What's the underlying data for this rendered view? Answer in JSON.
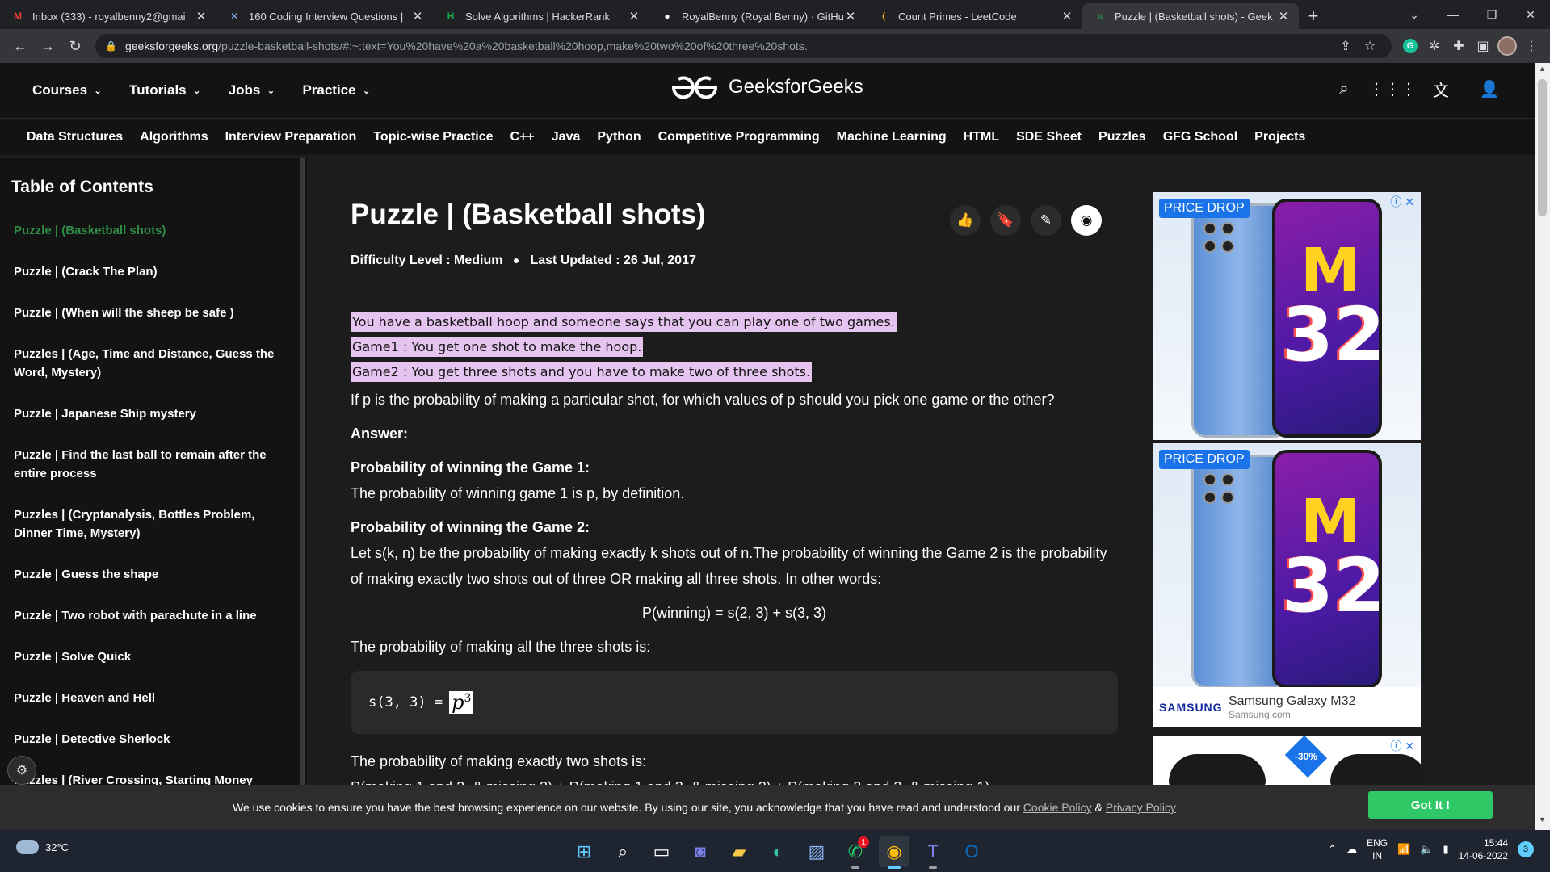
{
  "browser": {
    "tabs": [
      {
        "icon": "gmail-icon",
        "icon_char": "M",
        "icon_color": "#ea4335",
        "title": "Inbox (333) - royalbenny2@gmai"
      },
      {
        "icon": "x-close-icon",
        "icon_char": "✕",
        "icon_color": "#8ab4f8",
        "title": "160 Coding Interview Questions |"
      },
      {
        "icon": "hackerrank-icon",
        "icon_char": "H",
        "icon_color": "#1ba94c",
        "title": "Solve Algorithms | HackerRank"
      },
      {
        "icon": "github-icon",
        "icon_char": "●",
        "icon_color": "#ffffff",
        "title": "RoyalBenny (Royal Benny) · GitHu"
      },
      {
        "icon": "leetcode-icon",
        "icon_char": "⟨",
        "icon_color": "#ffa116",
        "title": "Count Primes - LeetCode"
      },
      {
        "icon": "gfg-icon",
        "icon_char": "ɞ",
        "icon_color": "#2f8d46",
        "title": "Puzzle | (Basketball shots) - Geek"
      }
    ],
    "url_host": "geeksforgeeks.org",
    "url_rest": "/puzzle-basketball-shots/#:~:text=You%20have%20a%20basketball%20hoop,make%20two%20of%20three%20shots."
  },
  "header": {
    "menu": [
      "Courses",
      "Tutorials",
      "Jobs",
      "Practice"
    ],
    "logo_text": "GeeksforGeeks",
    "subnav": [
      "Data Structures",
      "Algorithms",
      "Interview Preparation",
      "Topic-wise Practice",
      "C++",
      "Java",
      "Python",
      "Competitive Programming",
      "Machine Learning",
      "HTML",
      "SDE Sheet",
      "Puzzles",
      "GFG School",
      "Projects"
    ]
  },
  "toc": {
    "title": "Table of Contents",
    "items": [
      "Puzzle | (Basketball shots)",
      "Puzzle | (Crack The Plan)",
      "Puzzle | (When will the sheep be safe )",
      "Puzzles | (Age, Time and Distance, Guess the Word, Mystery)",
      "Puzzle | Japanese Ship mystery",
      "Puzzle | Find the last ball to remain after the entire process",
      "Puzzles | (Cryptanalysis, Bottles Problem, Dinner Time, Mystery)",
      "Puzzle | Guess the shape",
      "Puzzle | Two robot with parachute in a line",
      "Puzzle | Solve Quick",
      "Puzzle | Heaven and Hell",
      "Puzzle | Detective Sherlock",
      "Puzzles | (River Crossing, Starting Money"
    ]
  },
  "article": {
    "title": "Puzzle | (Basketball shots)",
    "difficulty": "Difficulty Level : Medium",
    "updated": "Last Updated : 26 Jul, 2017",
    "highlight1": "You have a basketball hoop and someone says that you can play one of two games.",
    "highlight2": "Game1 : You get one shot to make the hoop.",
    "highlight3": "Game2 : You get three shots and you have to make two of three shots.",
    "question": "If p is the probability of making a particular shot, for which values of p should you pick one game or the other?",
    "answer_label": "Answer:",
    "g1_heading": "Probability of winning the Game 1:",
    "g1_text": "The probability of winning game 1 is p, by definition.",
    "g2_heading": "Probability of winning the Game 2:",
    "g2_text": "Let s(k, n) be the probability of making exactly k shots out of n.The probability of winning the Game 2 is the probability of making exactly two shots out of three OR making all three shots. In other words:",
    "formula": "P(winning) = s(2, 3) + s(3, 3)",
    "all_three": "The probability of making all the three shots is:",
    "code_lhs": "s(3, 3) =",
    "code_p": "p",
    "code_exp": "3",
    "exactly_two": "The probability of making exactly two shots is:",
    "exactly_two_expr": "P(making 1 and 2, & missing 3) + P(making 1 and 3, & missing 2) + P(making 2 and 3, & missing 1)"
  },
  "ads": {
    "price_drop": "PRICE DROP",
    "model_m": "M",
    "model_num": "32",
    "brand": "SAMSUNG",
    "product": "Samsung Galaxy M32",
    "domain": "Samsung.com",
    "discount": "-30%"
  },
  "cookie": {
    "text": "We use cookies to ensure you have the best browsing experience on our website. By using our site, you acknowledge that you have read and understood our",
    "cookie_link": "Cookie Policy",
    "amp": "&",
    "privacy_link": "Privacy Policy",
    "button": "Got It !"
  },
  "taskbar": {
    "temp": "32°C",
    "lang1": "ENG",
    "lang2": "IN",
    "time": "15:44",
    "date": "14-06-2022",
    "notifications": "3",
    "whatsapp_badge": "1"
  }
}
